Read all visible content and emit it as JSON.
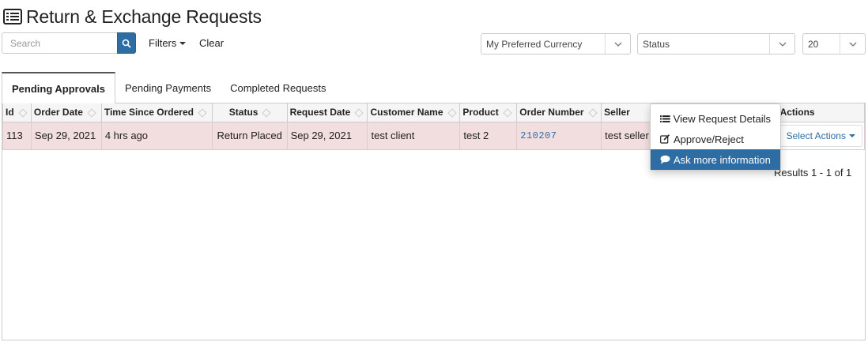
{
  "header": {
    "title": "Return & Exchange Requests",
    "icon": "list-icon"
  },
  "toolbar": {
    "search_placeholder": "Search",
    "filters_label": "Filters",
    "clear_label": "Clear",
    "currency_select": "My Preferred Currency",
    "status_select": "Status",
    "page_size_select": "20"
  },
  "tabs": [
    {
      "label": "Pending Approvals",
      "active": true
    },
    {
      "label": "Pending Payments",
      "active": false
    },
    {
      "label": "Completed Requests",
      "active": false
    }
  ],
  "table": {
    "columns": [
      "Id",
      "Order Date",
      "Time Since Ordered",
      "Status",
      "Request Date",
      "Customer Name",
      "Product",
      "Order Number",
      "Seller",
      "Actions"
    ],
    "rows": [
      {
        "id": "113",
        "order_date": "Sep 29, 2021",
        "time_since": "4 hrs ago",
        "status": "Return Placed",
        "request_date": "Sep 29, 2021",
        "customer": "test client",
        "product": "test 2",
        "order_number": "210207",
        "seller": "test seller",
        "action_label": "Select Actions"
      }
    ]
  },
  "results": "Results 1 - 1 of 1",
  "dropdown": {
    "items": [
      {
        "label": "View Request Details",
        "icon": "list-icon"
      },
      {
        "label": "Approve/Reject",
        "icon": "edit-icon"
      },
      {
        "label": "Ask more information",
        "icon": "comment-icon",
        "highlighted": true
      }
    ]
  },
  "colors": {
    "primary": "#2d6da3",
    "row_highlight": "#f2dede"
  }
}
